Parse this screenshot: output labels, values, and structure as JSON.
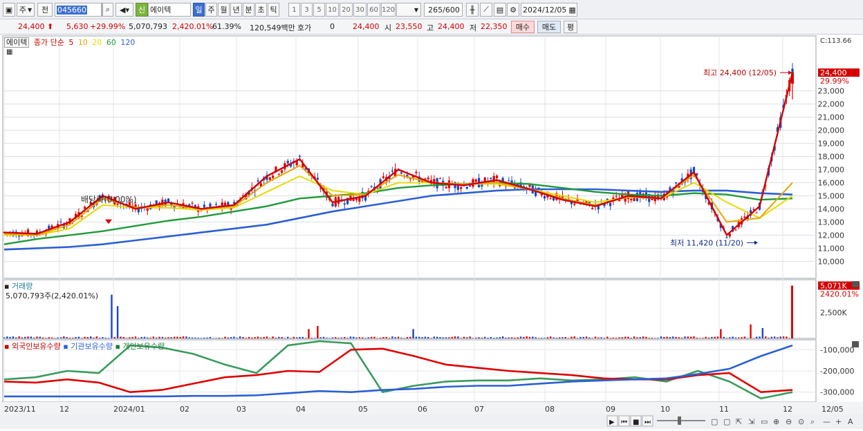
{
  "toolbar": {
    "market": "주",
    "prev": "전",
    "code": "045660",
    "badge": "신",
    "name": "에이텍",
    "periods": [
      "일",
      "주",
      "월",
      "년",
      "분",
      "초",
      "틱"
    ],
    "active_period": "일",
    "intervals": [
      "1",
      "3",
      "5",
      "10",
      "20",
      "30",
      "60",
      "120"
    ],
    "count": "265",
    "count_total": "/600",
    "date": "2024/12/05"
  },
  "info": {
    "price": "24,400",
    "change": "5,630",
    "change_pct": "+29.99%",
    "volume": "5,070,793",
    "vol_pct": "2,420.01%",
    "turnover": "61.39%",
    "amount": "120,549백만",
    "hoga_label": "호가",
    "hoga_value": "0",
    "hoga_price": "24,400",
    "open_label": "시",
    "open": "23,550",
    "high_label": "고",
    "high": "24,400",
    "low_label": "저",
    "low": "22,350",
    "buy": "매수",
    "sell": "매도",
    "eval": "평"
  },
  "legend": {
    "name": "에이텍",
    "ma_label": "종가 단순",
    "ma_periods": [
      "5",
      "10",
      "20",
      "60",
      "120"
    ],
    "ma_colors": [
      "#d40000",
      "#e6a600",
      "#e8d800",
      "#1f9a3a",
      "#2b5fd6"
    ],
    "volume_title": "거래량",
    "volume_value": "5,070,793주(2,420.01%)",
    "holders": [
      "외국인보유수량",
      "기관보유수량",
      "개인보유수량"
    ],
    "holder_colors": [
      "#d40000",
      "#2b5fd6",
      "#1f9a3a"
    ]
  },
  "annotations": {
    "dividend": "배당락(0.00%)",
    "high": "최고 24,400 (12/05)",
    "low": "최저 11,420 (11/20)"
  },
  "price_axis": {
    "top_label": "C:113.66",
    "current": "24,400",
    "current_pct": "29.99%",
    "ticks": [
      "23,000",
      "22,000",
      "21,000",
      "20,000",
      "19,000",
      "18,000",
      "17,000",
      "16,000",
      "15,000",
      "14,000",
      "13,000",
      "12,000",
      "11,000",
      "10,000"
    ]
  },
  "volume_axis": {
    "current": "5,071K",
    "current_pct": "2420.01%",
    "ticks": [
      "2,500K"
    ]
  },
  "holder_axis": {
    "ticks": [
      "-100,000",
      "-200,000",
      "-300,000"
    ]
  },
  "x_axis": {
    "labels": [
      "2023/11",
      "12",
      "2024/01",
      "02",
      "03",
      "04",
      "05",
      "06",
      "07",
      "08",
      "09",
      "10",
      "11",
      "12",
      "12/05"
    ]
  },
  "chart_data": {
    "type": "line",
    "ylim": [
      10000,
      24400
    ],
    "series": [
      {
        "name": "5",
        "values": [
          12200,
          12100,
          13000,
          15000,
          14000,
          14500,
          14000,
          14300,
          16500,
          17800,
          14500,
          15000,
          17000,
          16000,
          15800,
          16200,
          15500,
          14700,
          14200,
          15000,
          14800,
          16800,
          12000,
          14200,
          24400
        ]
      },
      {
        "name": "10",
        "values": [
          12100,
          12000,
          12800,
          14800,
          14100,
          14300,
          14000,
          14200,
          16000,
          17300,
          15000,
          15100,
          16600,
          16000,
          15900,
          16000,
          15500,
          14800,
          14300,
          14900,
          14800,
          16600,
          13000,
          13300,
          16000
        ]
      },
      {
        "name": "20",
        "values": [
          12000,
          12000,
          12500,
          14300,
          14100,
          14100,
          13900,
          14100,
          15300,
          16500,
          15400,
          15100,
          16000,
          16000,
          15900,
          15900,
          15500,
          15000,
          14500,
          14900,
          14800,
          16000,
          14500,
          13300,
          15000
        ]
      },
      {
        "name": "60",
        "values": [
          11300,
          11700,
          12000,
          12300,
          12700,
          13100,
          13400,
          13800,
          14200,
          14800,
          15000,
          15200,
          15600,
          15800,
          15900,
          16000,
          15900,
          15600,
          15300,
          15100,
          15000,
          15200,
          15100,
          14700,
          14800
        ]
      },
      {
        "name": "120",
        "values": [
          10900,
          11000,
          11100,
          11300,
          11600,
          11900,
          12200,
          12500,
          12800,
          13300,
          13800,
          14200,
          14600,
          15000,
          15200,
          15400,
          15500,
          15500,
          15500,
          15400,
          15300,
          15400,
          15400,
          15200,
          15100
        ]
      }
    ],
    "volume": {
      "unit": "K",
      "current": 5071
    }
  }
}
